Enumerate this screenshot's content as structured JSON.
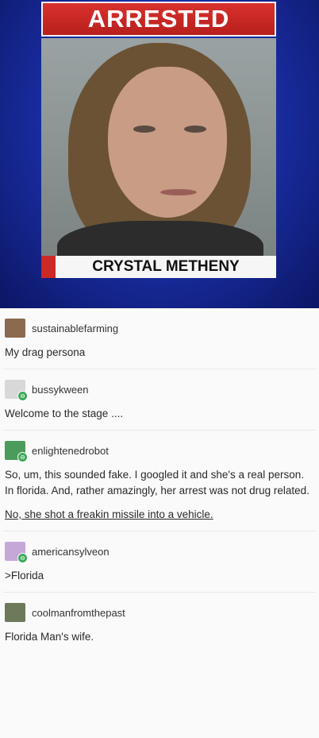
{
  "news_image": {
    "banner": "ARRESTED",
    "caption": "CRYSTAL METHENY"
  },
  "posts": [
    {
      "username": "sustainablefarming",
      "avatar_color": "#8b6a4f",
      "texts": [
        "My drag persona"
      ]
    },
    {
      "username": "bussykween",
      "avatar_color": "#d8d8d8",
      "texts": [
        "Welcome to the stage ...."
      ]
    },
    {
      "username": "enlightenedrobot",
      "avatar_color": "#4b9b5a",
      "texts": [
        "So, um, this sounded fake. I googled it and she's a real person. In florida. And, rather amazingly, her arrest was not drug related.",
        "No, she shot a freakin missile into a vehicle."
      ]
    },
    {
      "username": "americansylveon",
      "avatar_color": "#c7a6d8",
      "texts": [
        ">Florida"
      ]
    },
    {
      "username": "coolmanfromthepast",
      "avatar_color": "#6c7a5a",
      "texts": [
        "Florida Man's wife."
      ]
    }
  ]
}
